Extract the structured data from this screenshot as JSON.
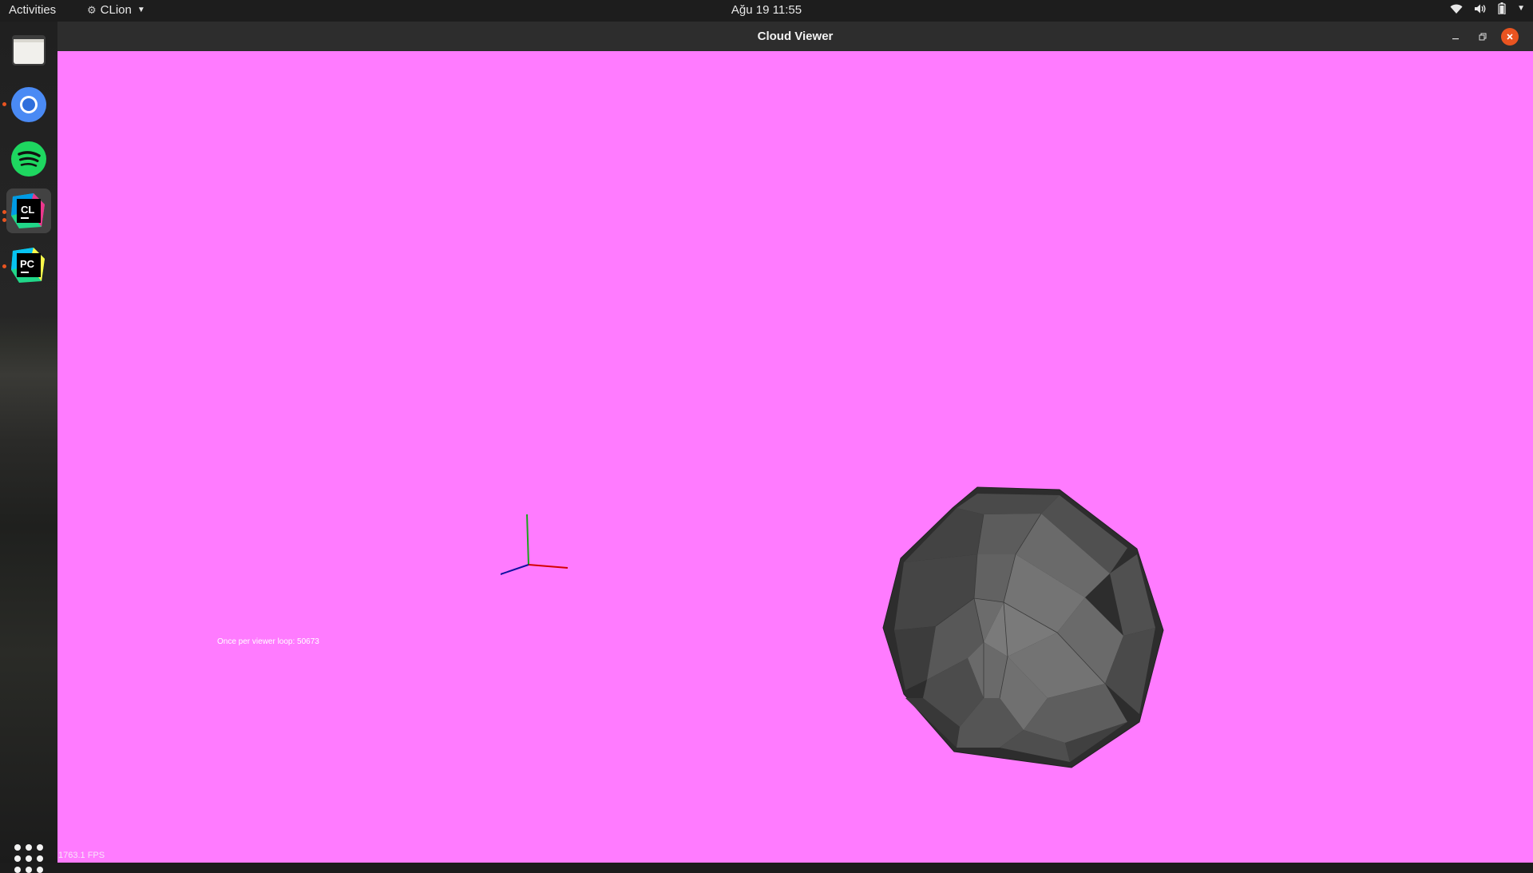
{
  "topbar": {
    "activities": "Activities",
    "app_name": "CLion",
    "clock": "Ağu 19  11:55"
  },
  "dock": {
    "items": [
      "files",
      "chromium",
      "spotify",
      "clion",
      "pycharm"
    ],
    "clion_label": "CL",
    "pycharm_label": "PC"
  },
  "window": {
    "title": "Cloud Viewer",
    "background_color": "#ff7bff"
  },
  "viewport": {
    "loop_text": "Once per viewer loop: 50673",
    "fps_text": "1763.1 FPS"
  },
  "colors": {
    "accent": "#e95420",
    "axis_x": "#d40000",
    "axis_y": "#1aa31a",
    "axis_z": "#1010a0"
  }
}
